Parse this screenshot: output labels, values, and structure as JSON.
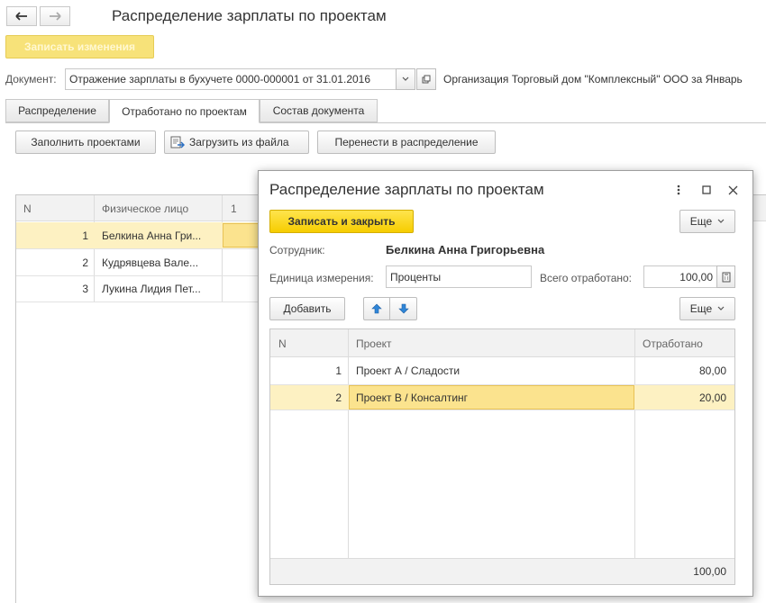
{
  "window": {
    "title": "Распределение зарплаты по проектам",
    "save_button": "Записать изменения",
    "document_label": "Документ:",
    "document_value": "Отражение зарплаты в бухучете 0000-000001 от 31.01.2016",
    "org_text": "Организация Торговый дом \"Комплексный\" ООО за Январь"
  },
  "tabs": [
    {
      "label": "Распределение"
    },
    {
      "label": "Отработано по проектам"
    },
    {
      "label": "Состав документа"
    }
  ],
  "toolbar": {
    "fill_projects": "Заполнить проектами",
    "load_from_file": "Загрузить из файла",
    "move_to_distribution": "Перенести в распределение"
  },
  "table": {
    "columns": [
      "N",
      "Физическое лицо",
      "1"
    ],
    "rows": [
      {
        "n": "1",
        "person": "Белкина Анна Гри..."
      },
      {
        "n": "2",
        "person": "Кудрявцева Вале..."
      },
      {
        "n": "3",
        "person": "Лукина Лидия Пет..."
      }
    ]
  },
  "dialog": {
    "title": "Распределение зарплаты по проектам",
    "save_close": "Записать и закрыть",
    "more_label": "Еще",
    "employee_label": "Сотрудник:",
    "employee_value": "Белкина Анна Григорьевна",
    "unit_label": "Единица измерения:",
    "unit_value": "Проценты",
    "total_label": "Всего отработано:",
    "total_value": "100,00",
    "add_button": "Добавить",
    "table": {
      "columns": [
        "N",
        "Проект",
        "Отработано"
      ],
      "rows": [
        {
          "n": "1",
          "project": "Проект А / Сладости",
          "worked": "80,00"
        },
        {
          "n": "2",
          "project": "Проект В / Консалтинг",
          "worked": "20,00"
        }
      ],
      "footer_total": "100,00"
    }
  },
  "colors": {
    "accent_yellow": "#f6cd00",
    "selected_row": "#fdf1c2",
    "selected_cell": "#fbe38e"
  }
}
